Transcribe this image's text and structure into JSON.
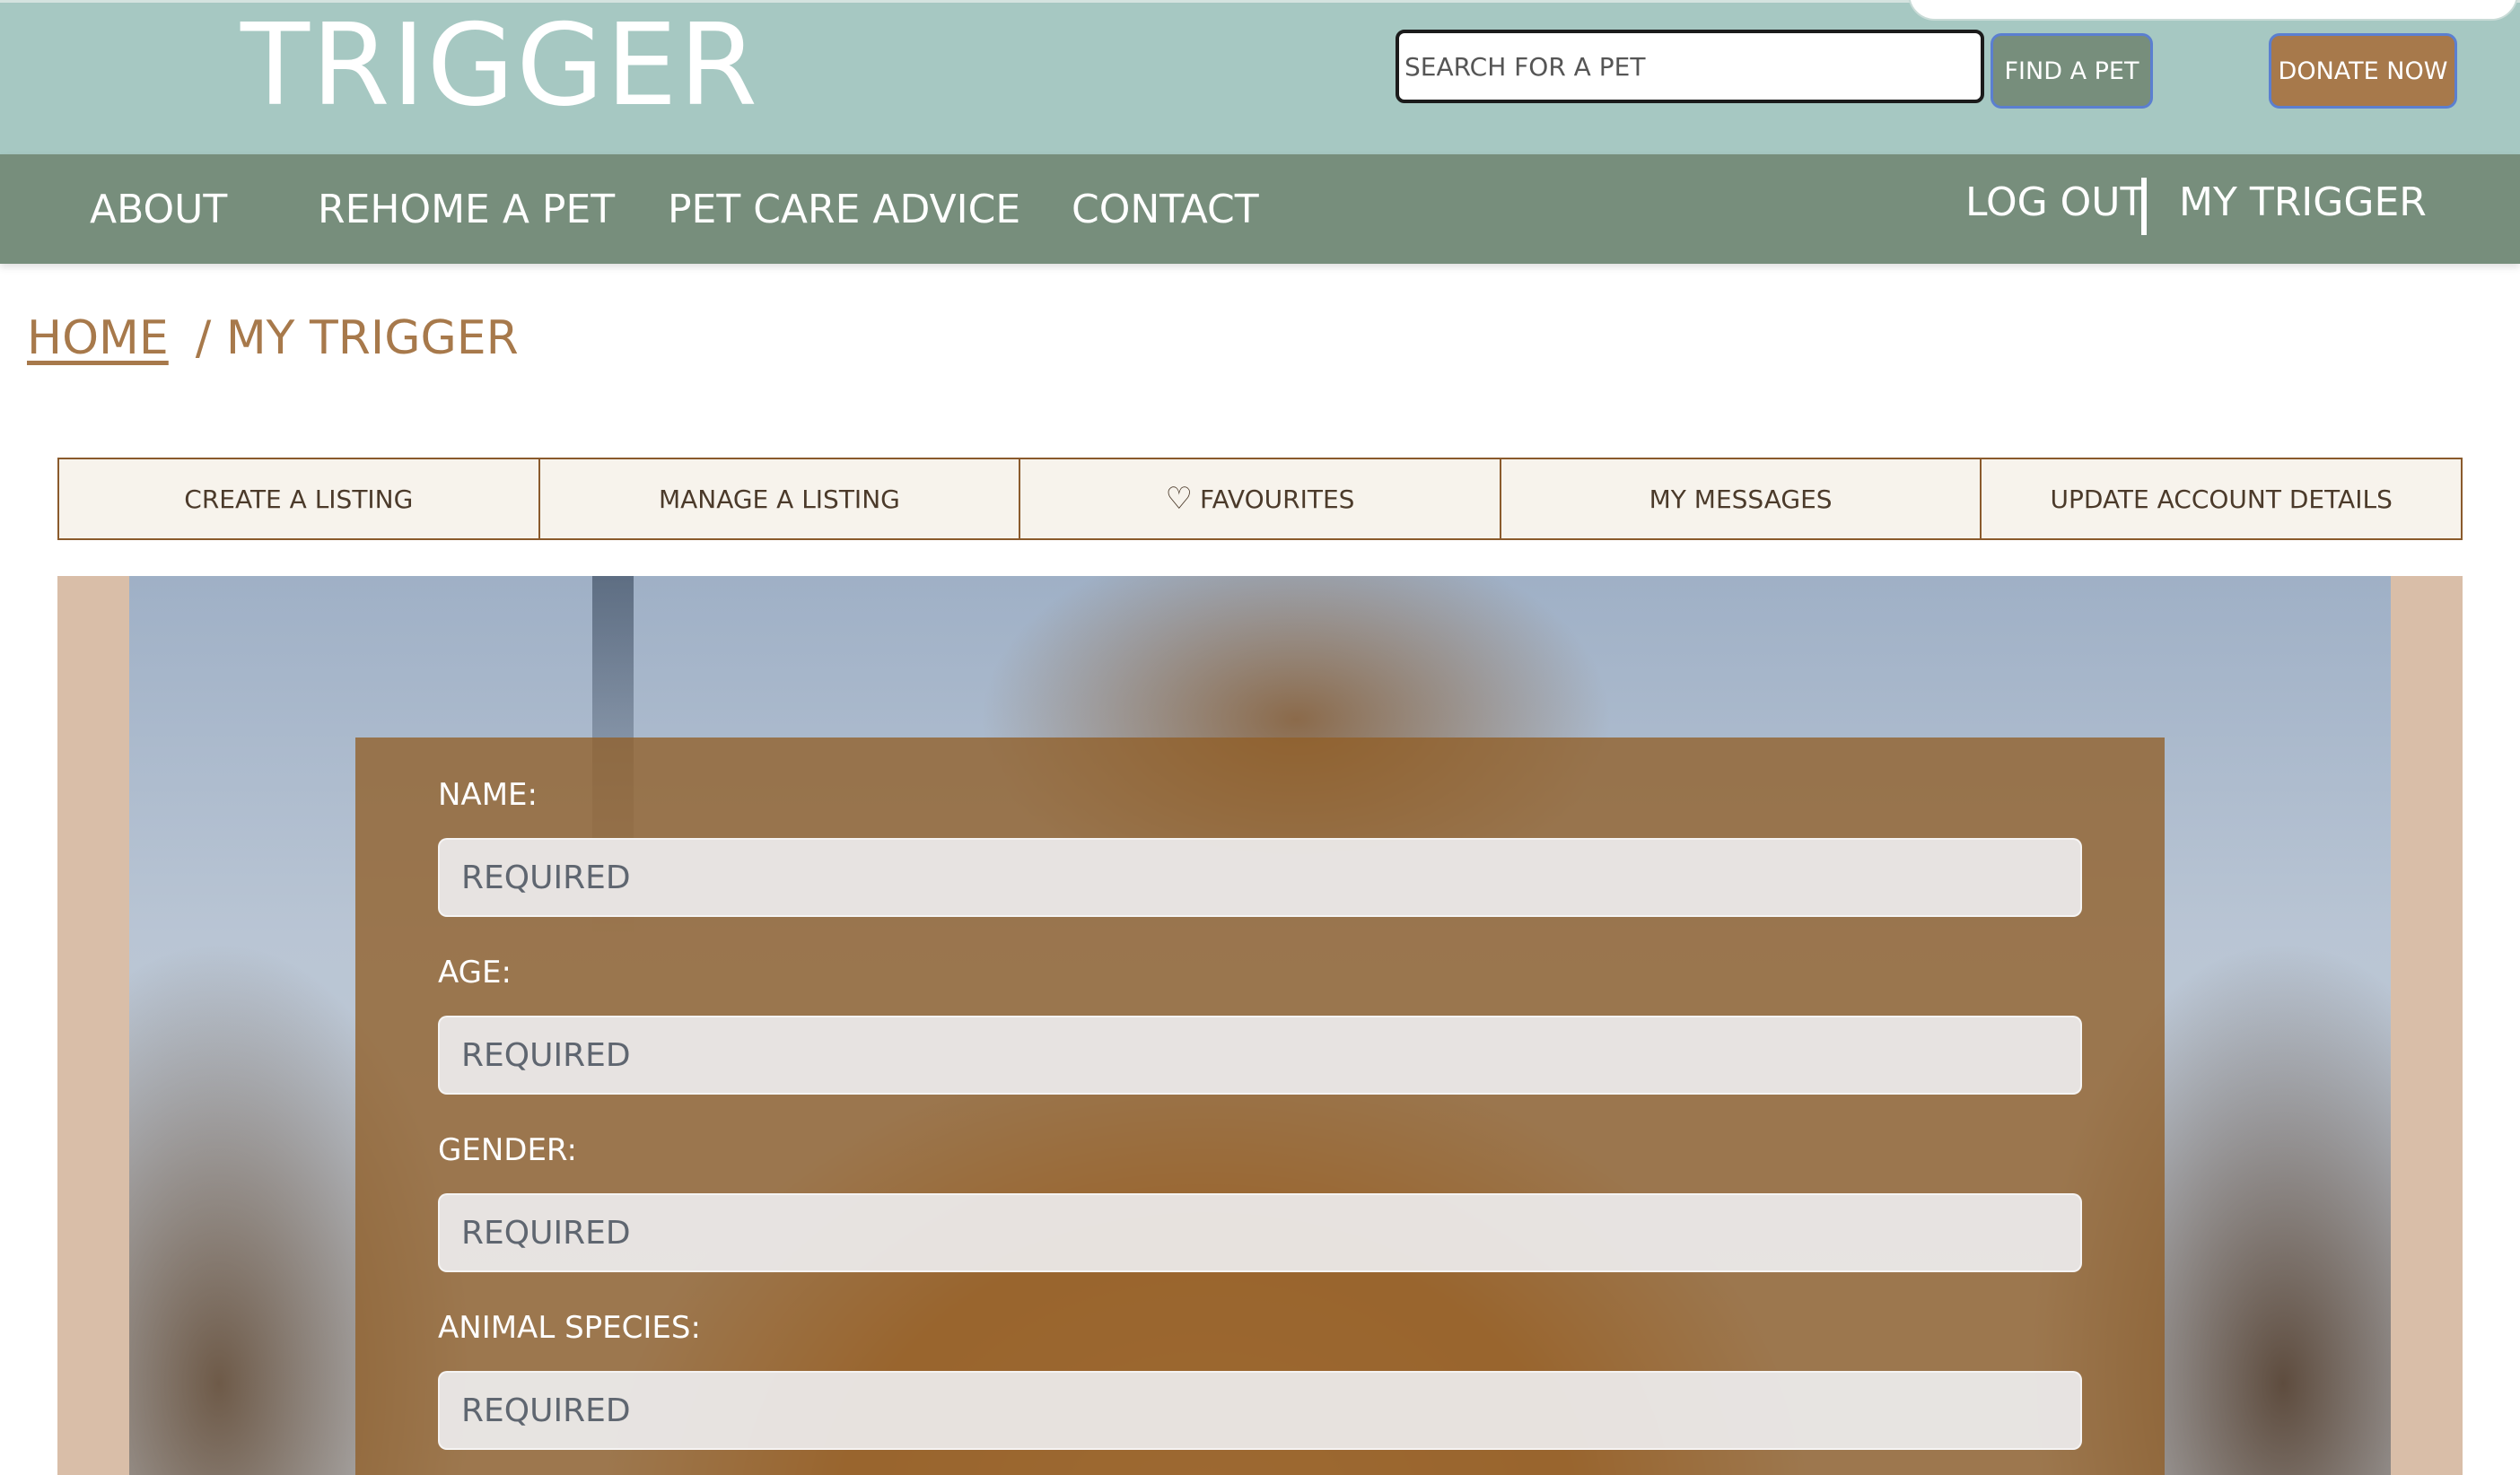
{
  "header": {
    "logo": "TRIGGER",
    "search_placeholder": "SEARCH FOR A PET",
    "find_label": "FIND A PET",
    "donate_label": "DONATE NOW"
  },
  "nav": {
    "items": [
      "ABOUT",
      "REHOME A PET",
      "PET CARE ADVICE",
      "CONTACT"
    ],
    "logout": "LOG OUT",
    "account": "MY TRIGGER"
  },
  "breadcrumb": {
    "home": "HOME",
    "current": "/ MY TRIGGER"
  },
  "tabs": [
    {
      "label": "CREATE A LISTING"
    },
    {
      "label": "MANAGE A LISTING"
    },
    {
      "label": "FAVOURITES",
      "icon": "heart-icon"
    },
    {
      "label": "MY MESSAGES"
    },
    {
      "label": "UPDATE ACCOUNT DETAILS"
    }
  ],
  "form": {
    "fields": [
      {
        "label": "NAME:",
        "placeholder": "REQUIRED"
      },
      {
        "label": "AGE:",
        "placeholder": "REQUIRED"
      },
      {
        "label": "GENDER:",
        "placeholder": "REQUIRED"
      },
      {
        "label": "ANIMAL SPECIES:",
        "placeholder": "REQUIRED"
      }
    ]
  },
  "colors": {
    "header_bg": "#a6c8c2",
    "nav_bg": "#778e7c",
    "accent_brown": "#a7794b",
    "tab_bg": "#f7f3ec",
    "frame_bg": "#d9bea8"
  }
}
